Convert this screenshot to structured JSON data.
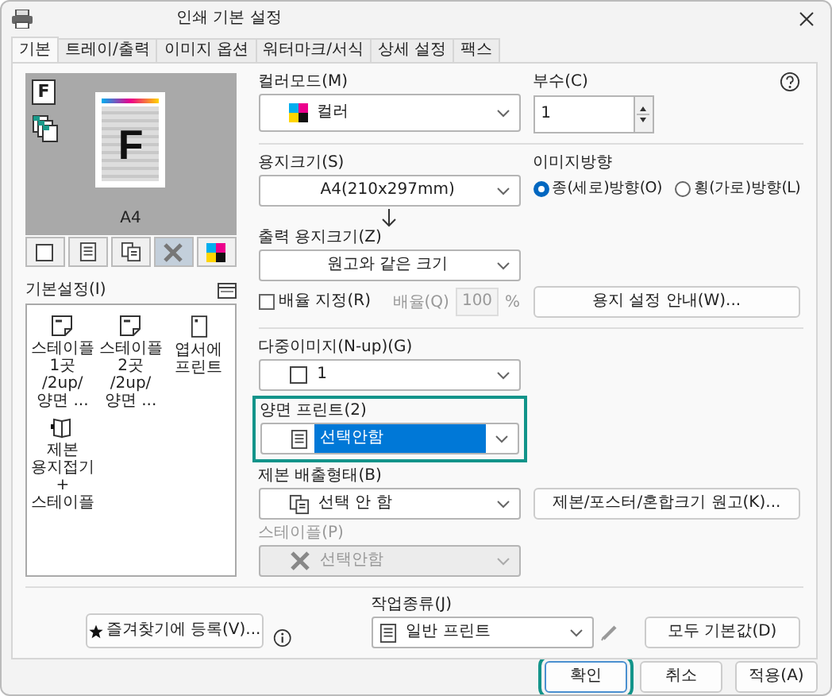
{
  "window": {
    "title": "인쇄 기본 설정"
  },
  "tabs": [
    {
      "label": "기본",
      "selected": true
    },
    {
      "label": "트레이/출력",
      "selected": false
    },
    {
      "label": "이미지 옵션",
      "selected": false
    },
    {
      "label": "워터마크/서식",
      "selected": false
    },
    {
      "label": "상세 설정",
      "selected": false
    },
    {
      "label": "팩스",
      "selected": false
    }
  ],
  "preview": {
    "page_letter": "F",
    "paper": "A4",
    "mode_icons": [
      {
        "kind": "single",
        "letter": "F"
      },
      {
        "kind": "collate"
      }
    ]
  },
  "view_buttons": [
    {
      "kind": "page",
      "selected": false
    },
    {
      "kind": "document",
      "selected": false
    },
    {
      "kind": "copies",
      "selected": false
    },
    {
      "kind": "staple",
      "selected": true
    },
    {
      "kind": "color",
      "selected": false
    }
  ],
  "presets": {
    "label": "기본설정(I)",
    "items": [
      {
        "kind": "staple",
        "label": "스테이플 1곳 /2up/양면 ..."
      },
      {
        "kind": "staple",
        "label": "스테이플 2곳 /2up/양면 ..."
      },
      {
        "kind": "postcard",
        "label": "엽서에 프린트"
      },
      {
        "kind": "booklet",
        "label": "제본 용지접기+ 스테이플"
      }
    ]
  },
  "color_mode": {
    "label": "컬러모드(M)",
    "value": "컬러"
  },
  "copies": {
    "label": "부수(C)",
    "value": "1"
  },
  "paper_size": {
    "label": "용지크기(S)",
    "value": "A4(210x297mm)"
  },
  "orientation": {
    "label": "이미지방향",
    "options": [
      {
        "label": "종(세로)방향(O)",
        "selected": true
      },
      {
        "label": "횡(가로)방향(L)",
        "selected": false
      }
    ]
  },
  "output_size": {
    "label": "출력 용지크기(Z)",
    "value": "원고와 같은 크기"
  },
  "scale": {
    "label": "배율 지정(R)",
    "checked": false,
    "ratio_label": "배율(Q)",
    "ratio_value": "100",
    "unit": "%"
  },
  "paper_guide_button": "용지 설정 안내(W)...",
  "nup": {
    "label": "다중이미지(N-up)(G)",
    "value": "1"
  },
  "duplex": {
    "label": "양면 프린트(2)",
    "value": "선택안함",
    "focused": true,
    "highlighted": true
  },
  "binding": {
    "label": "제본 배출형태(B)",
    "value": "선택 안 함"
  },
  "binding_button": "제본/포스터/혼합크기 원고(K)...",
  "staple": {
    "label": "스테이플(P)",
    "value": "선택안함",
    "disabled": true
  },
  "favorite_button": "즐겨찾기에 등록(V)...",
  "job_type": {
    "label": "작업종류(J)",
    "value": "일반 프린트"
  },
  "reset_button": "모두 기본값(D)",
  "footer_buttons": [
    {
      "label": "확인",
      "highlighted": true
    },
    {
      "label": "취소",
      "highlighted": false
    },
    {
      "label": "적용(A)",
      "highlighted": false
    }
  ]
}
